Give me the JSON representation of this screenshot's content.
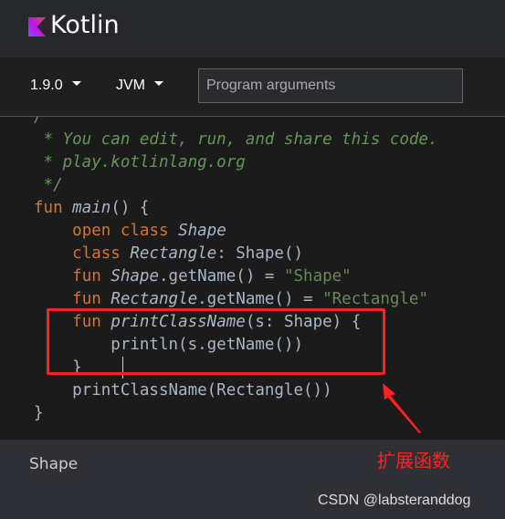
{
  "header": {
    "brand": "Kotlin",
    "logo": "kotlin-logo"
  },
  "toolbar": {
    "version": "1.9.0",
    "target": "JVM",
    "args_placeholder": "Program arguments",
    "args_value": ""
  },
  "editor": {
    "lines": [
      [
        [
          "c",
          "/**"
        ]
      ],
      [
        [
          "c",
          " * You can edit, run, and share this code."
        ]
      ],
      [
        [
          "c",
          " * play.kotlinlang.org"
        ]
      ],
      [
        [
          "c",
          " */"
        ]
      ],
      [
        [
          "k",
          "fun "
        ],
        [
          "i",
          "main"
        ],
        [
          "t",
          "() {"
        ]
      ],
      [
        [
          "t",
          "    "
        ],
        [
          "k",
          "open class "
        ],
        [
          "i",
          "Shape"
        ]
      ],
      [
        [
          "t",
          "    "
        ],
        [
          "k",
          "class "
        ],
        [
          "i",
          "Rectangle"
        ],
        [
          "t",
          ": Shape()"
        ]
      ],
      [
        [
          "t",
          "    "
        ],
        [
          "k",
          "fun "
        ],
        [
          "i",
          "Shape"
        ],
        [
          "t",
          ".getName() = "
        ],
        [
          "s",
          "\"Shape\""
        ]
      ],
      [
        [
          "t",
          "    "
        ],
        [
          "k",
          "fun "
        ],
        [
          "i",
          "Rectangle"
        ],
        [
          "t",
          ".getName() = "
        ],
        [
          "s",
          "\"Rectangle\""
        ]
      ],
      [
        [
          "t",
          "    "
        ],
        [
          "k",
          "fun "
        ],
        [
          "i",
          "printClassName"
        ],
        [
          "t",
          "(s: Shape) {"
        ]
      ],
      [
        [
          "t",
          "        println(s.getName())"
        ]
      ],
      [
        [
          "t",
          "    }"
        ]
      ],
      [
        [
          "t",
          "    printClassName(Rectangle())"
        ]
      ],
      [
        [
          "t",
          "}"
        ]
      ]
    ]
  },
  "output": {
    "text": "Shape"
  },
  "annotation": {
    "label": "扩展函数",
    "color": "#ff2020"
  },
  "watermark": "CSDN @labsteranddog"
}
